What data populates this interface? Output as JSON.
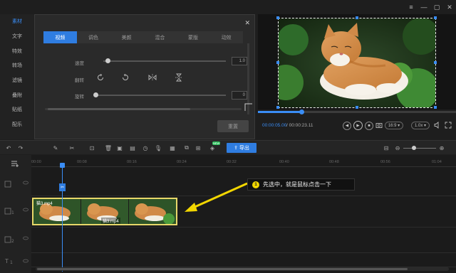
{
  "window_controls": {
    "menu": "≡",
    "minimize": "—",
    "maximize": "▢",
    "close": "✕"
  },
  "sidebar": {
    "items": [
      {
        "label": "素材"
      },
      {
        "label": "文字"
      },
      {
        "label": "特效"
      },
      {
        "label": "转场"
      },
      {
        "label": "滤镜"
      },
      {
        "label": "叠附"
      },
      {
        "label": "贴纸"
      },
      {
        "label": "配乐"
      }
    ],
    "active_index": 0
  },
  "panel": {
    "close": "✕",
    "tabs": [
      {
        "label": "视频"
      },
      {
        "label": "调色"
      },
      {
        "label": "美颜"
      },
      {
        "label": "混合"
      },
      {
        "label": "蒙版"
      },
      {
        "label": "动效"
      }
    ],
    "active_tab": 0,
    "speed": {
      "label": "速度",
      "value": "1.0"
    },
    "flip": {
      "label": "翻转"
    },
    "rotate": {
      "label": "旋转",
      "value": "0"
    },
    "reset_label": "重置"
  },
  "player": {
    "time_current": "00:00:05.00",
    "time_total": "/ 00:00:23.11",
    "progress": 0.22,
    "aspect": "16:9",
    "speed": "1.0x"
  },
  "toolbar": {
    "export_label": "导出",
    "new_badge": "NEW"
  },
  "timeline": {
    "ruler": [
      "00:00",
      "00:08",
      "00:16",
      "00:24",
      "00:32",
      "00:40",
      "00:48",
      "00:56",
      "01:04"
    ],
    "clip_name": "猫3.mp4",
    "clip_name_top": "猫3.mp4"
  },
  "callout": {
    "number": "1",
    "text": "先选中，就是鼠标点击一下",
    "color": "#f2d600"
  }
}
